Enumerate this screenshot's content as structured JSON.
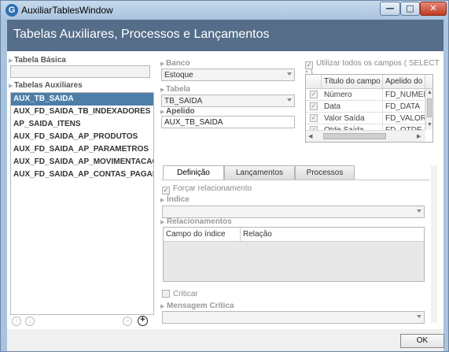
{
  "window": {
    "title": "AuxiliarTablesWindow",
    "icon_glyph": "G",
    "controls": {
      "minimize": "—",
      "maximize": "□",
      "close": "✕"
    }
  },
  "header": {
    "title": "Tabelas Auxiliares, Processos e Lançamentos"
  },
  "left": {
    "tabela_basica_label": "Tabela Básica",
    "tabela_basica_value": "",
    "tabelas_auxiliares_label": "Tabelas Auxiliares",
    "items": [
      "AUX_TB_SAIDA",
      "AUX_FD_SAIDA_TB_INDEXADORES",
      "AP_SAIDA_ITENS",
      "AUX_FD_SAIDA_AP_PRODUTOS",
      "AUX_FD_SAIDA_AP_PARAMETROS",
      "AUX_FD_SAIDA_AP_MOVIMENTACAO",
      "AUX_FD_SAIDA_AP_CONTAS_PAGAR_ITENS"
    ],
    "selected_index": 0,
    "up_icon": "↑",
    "down_icon": "↓",
    "remove_icon": "−",
    "add_icon": "+"
  },
  "form": {
    "banco_label": "Banco",
    "banco_value": "Estoque",
    "tabela_label": "Tabela",
    "tabela_value": "TB_SAIDA",
    "apelido_label": "Apelido",
    "apelido_value": "AUX_TB_SAIDA"
  },
  "fields_grid": {
    "use_all_label": "Utilizar todos os campos ( SELECT * )",
    "use_all_checked": true,
    "columns": [
      "Título do campo",
      "Apelido do"
    ],
    "rows": [
      {
        "title": "Número",
        "alias": "FD_NUMER"
      },
      {
        "title": "Data",
        "alias": "FD_DATA"
      },
      {
        "title": "Valor Saída",
        "alias": "FD_VALOR"
      },
      {
        "title": "Qtde Saída",
        "alias": "FD_QTDE_S"
      }
    ]
  },
  "tabs": [
    "Definição",
    "Lançamentos",
    "Processos"
  ],
  "active_tab": 0,
  "definicao": {
    "forcar_label": "Forçar relacionamento",
    "forcar_checked": true,
    "indice_label": "Índice",
    "indice_value": "",
    "relacionamentos_label": "Relacionamentos",
    "rel_columns": [
      "Campo do índice",
      "Relação"
    ],
    "criticar_label": "Criticar",
    "criticar_checked": false,
    "mensagem_label": "Mensagem Crítica",
    "mensagem_value": ""
  },
  "footer": {
    "ok_label": "OK"
  }
}
